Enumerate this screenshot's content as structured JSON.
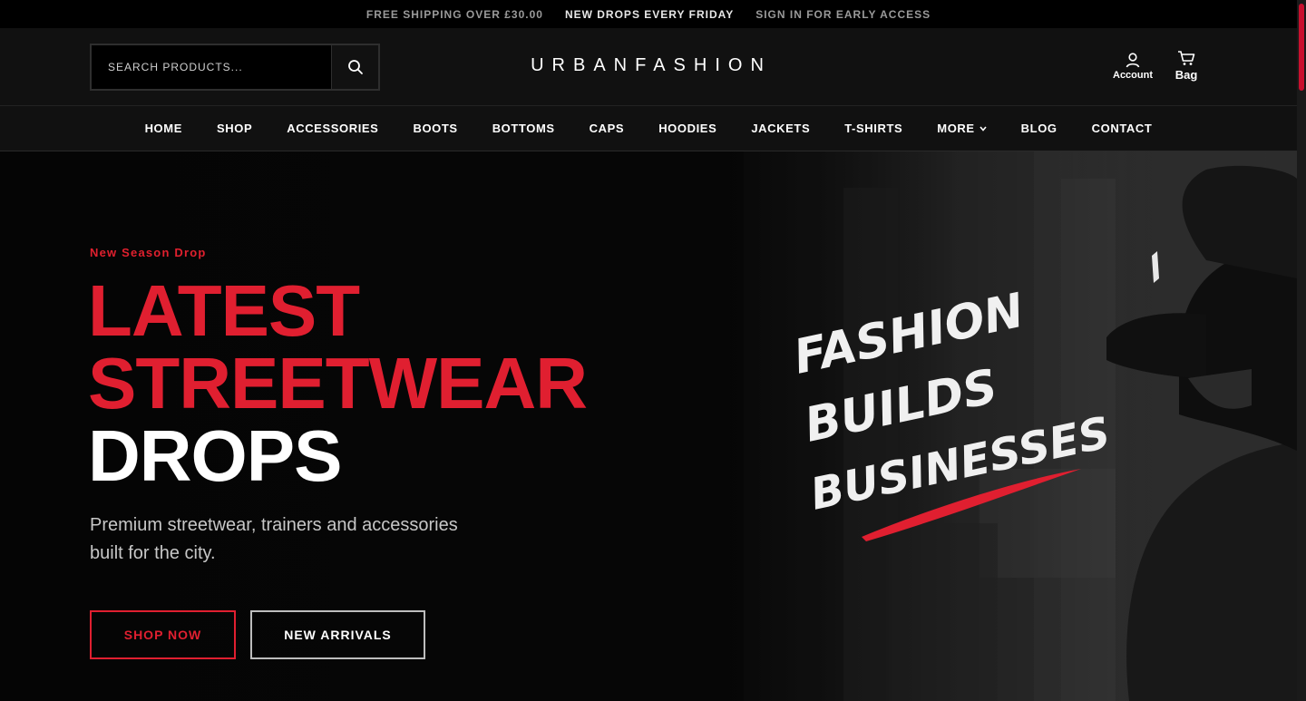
{
  "topbar": {
    "items": [
      "FREE SHIPPING OVER £30.00",
      "NEW DROPS EVERY FRIDAY",
      "SIGN IN FOR EARLY ACCESS"
    ]
  },
  "header": {
    "search_placeholder": "SEARCH PRODUCTS...",
    "logo": "URBANFASHION",
    "account_label": "Account",
    "bag_label": "Bag"
  },
  "nav": {
    "items": [
      "HOME",
      "SHOP",
      "ACCESSORIES",
      "BOOTS",
      "BOTTOMS",
      "CAPS",
      "HOODIES",
      "JACKETS",
      "T-SHIRTS",
      "MORE",
      "BLOG",
      "CONTACT"
    ]
  },
  "hero": {
    "kicker": "New Season Drop",
    "headline_line1": "LATEST",
    "headline_line2": "STREETWEAR",
    "headline_line3": "DROPS",
    "subtitle": "Premium streetwear, trainers and accessories built for the city.",
    "primary_button": "SHOP NOW",
    "secondary_button": "NEW ARRIVALS",
    "tagline_line1": "FASHION",
    "tagline_line2": "BUILDS",
    "tagline_line3": "BUSINESSES"
  },
  "colors": {
    "accent": "#e01f30",
    "background": "#0a0a0a",
    "header": "#111111"
  }
}
